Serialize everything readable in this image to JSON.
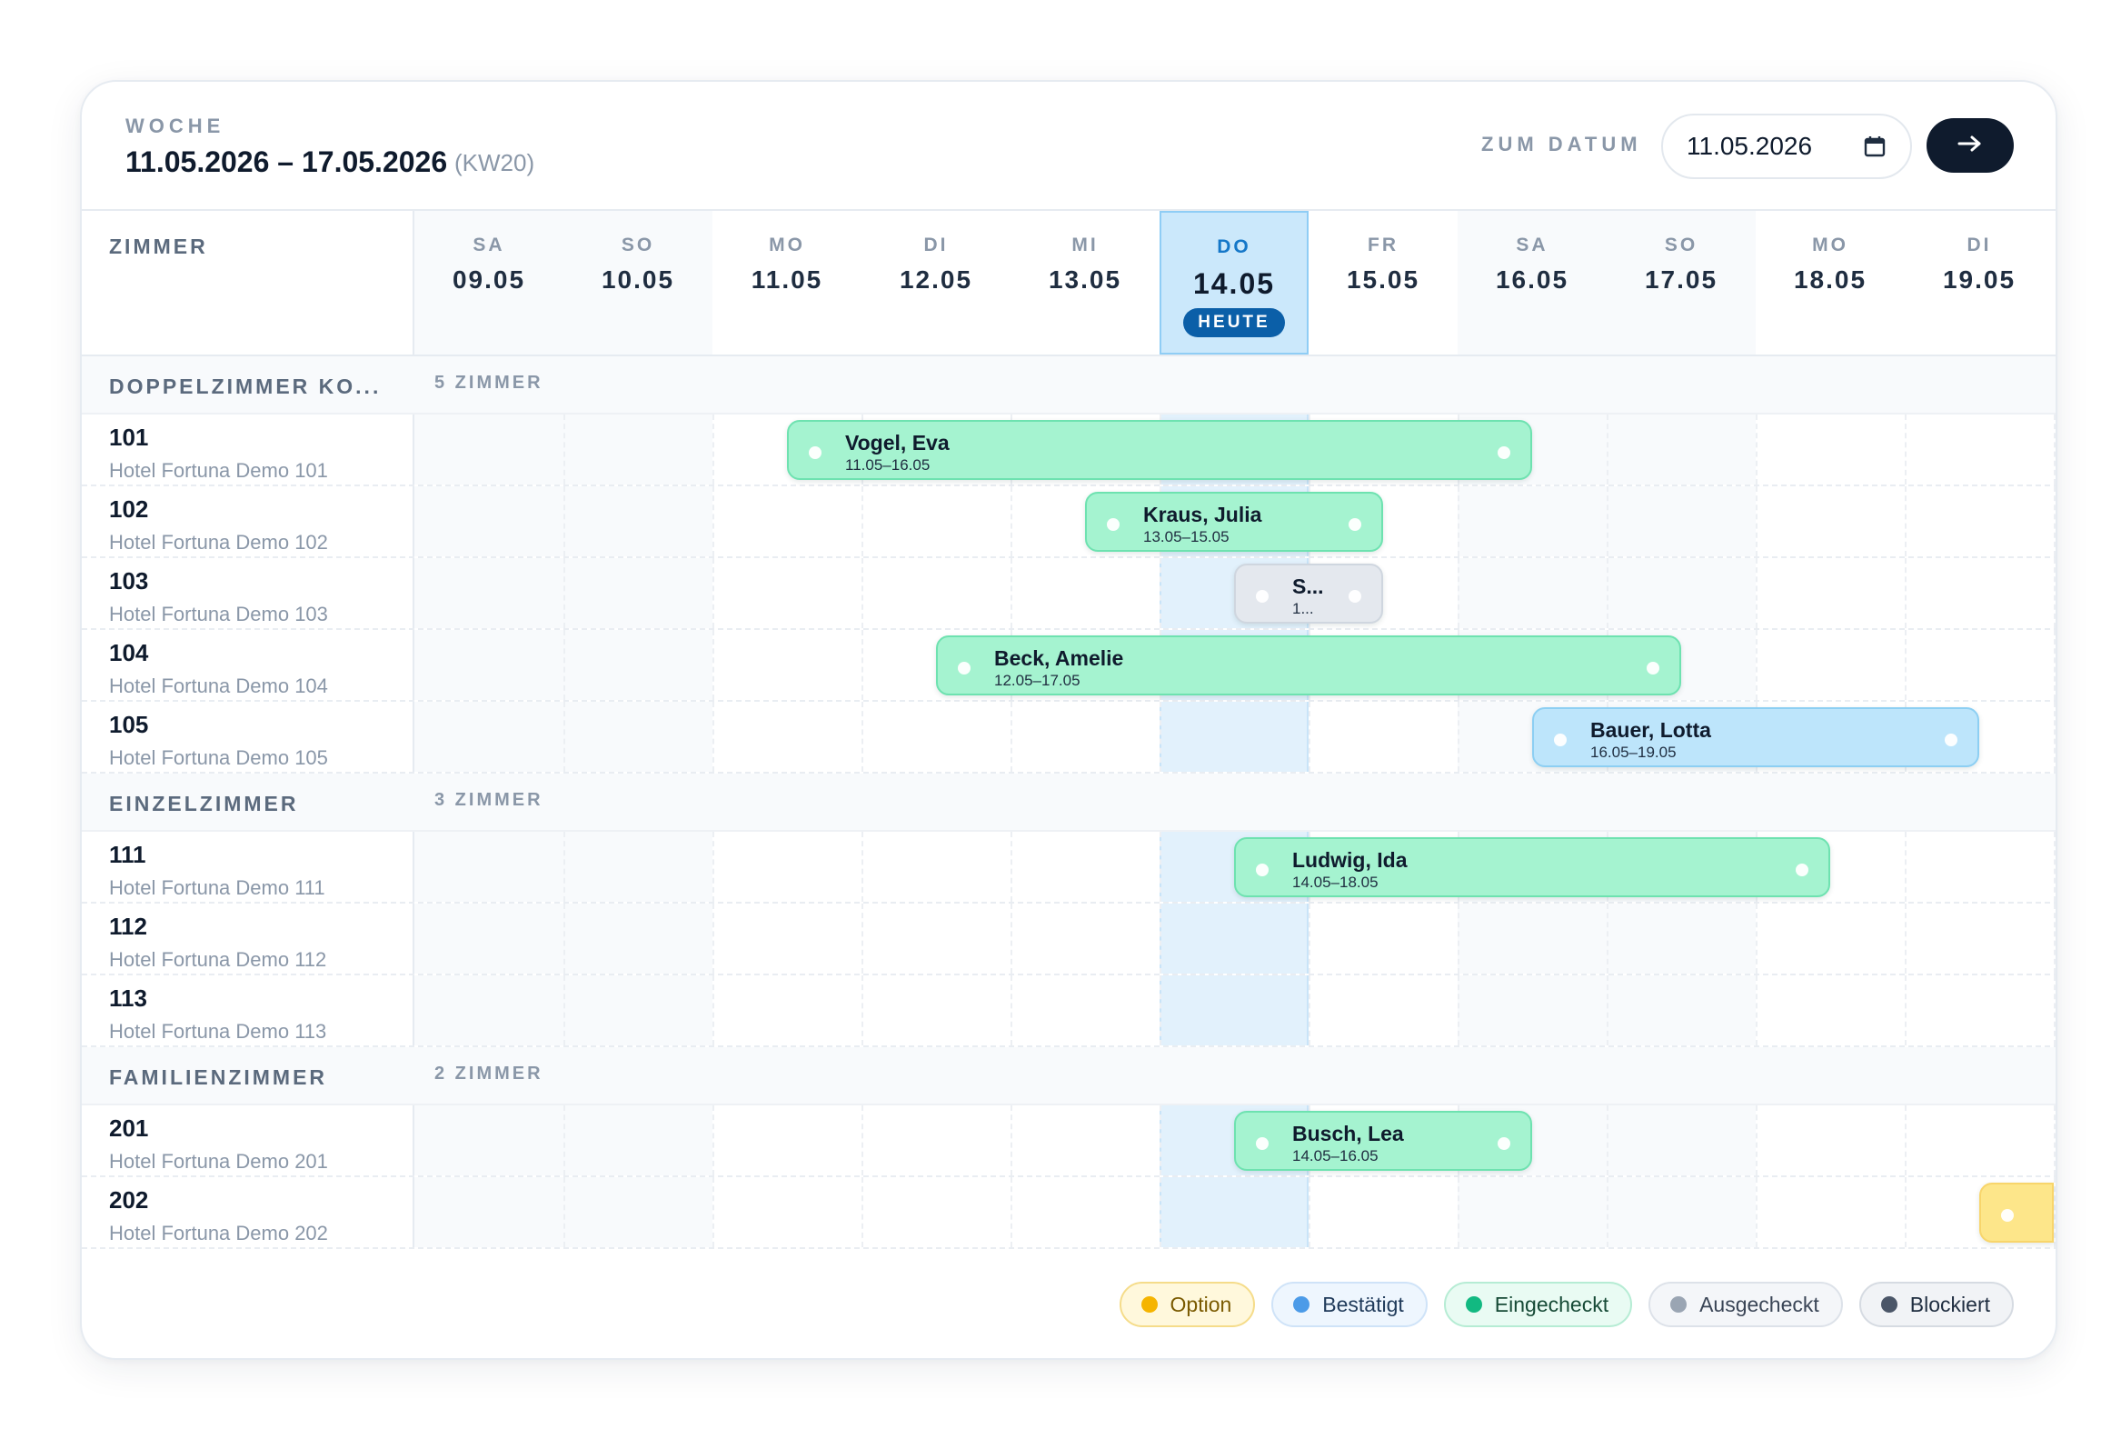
{
  "header": {
    "week_label": "WOCHE",
    "week_range": "11.05.2026 – 17.05.2026",
    "week_kw": "(KW20)",
    "goto_label": "ZUM DATUM",
    "date_value": "11.05.2026",
    "calendar_icon": "calendar-icon",
    "go_icon": "arrow-right-icon"
  },
  "grid": {
    "rooms_header": "ZIMMER",
    "today_badge": "HEUTE",
    "days": [
      {
        "dow": "SA",
        "date": "09.05"
      },
      {
        "dow": "SO",
        "date": "10.05"
      },
      {
        "dow": "MO",
        "date": "11.05"
      },
      {
        "dow": "DI",
        "date": "12.05"
      },
      {
        "dow": "MI",
        "date": "13.05"
      },
      {
        "dow": "DO",
        "date": "14.05"
      },
      {
        "dow": "FR",
        "date": "15.05"
      },
      {
        "dow": "SA",
        "date": "16.05"
      },
      {
        "dow": "SO",
        "date": "17.05"
      },
      {
        "dow": "MO",
        "date": "18.05"
      },
      {
        "dow": "DI",
        "date": "19.05"
      }
    ],
    "groups": [
      {
        "name": "DOPPELZIMMER KO...",
        "count": "5 ZIMMER",
        "rooms": [
          {
            "no": "101",
            "hotel": "Hotel Fortuna Demo 101"
          },
          {
            "no": "102",
            "hotel": "Hotel Fortuna Demo 102"
          },
          {
            "no": "103",
            "hotel": "Hotel Fortuna Demo 103"
          },
          {
            "no": "104",
            "hotel": "Hotel Fortuna Demo 104"
          },
          {
            "no": "105",
            "hotel": "Hotel Fortuna Demo 105"
          }
        ]
      },
      {
        "name": "EINZELZIMMER",
        "count": "3 ZIMMER",
        "rooms": [
          {
            "no": "111",
            "hotel": "Hotel Fortuna Demo 111"
          },
          {
            "no": "112",
            "hotel": "Hotel Fortuna Demo 112"
          },
          {
            "no": "113",
            "hotel": "Hotel Fortuna Demo 113"
          }
        ]
      },
      {
        "name": "FAMILIENZIMMER",
        "count": "2 ZIMMER",
        "rooms": [
          {
            "no": "201",
            "hotel": "Hotel Fortuna Demo 201"
          },
          {
            "no": "202",
            "hotel": "Hotel Fortuna Demo 202"
          }
        ]
      }
    ],
    "bookings": [
      {
        "guest": "Vogel, Eva",
        "dates": "11.05–16.05",
        "status": "green"
      },
      {
        "guest": "Kraus, Julia",
        "dates": "13.05–15.05",
        "status": "green"
      },
      {
        "guest": "S...",
        "dates": "1...",
        "status": "grey"
      },
      {
        "guest": "Beck, Amelie",
        "dates": "12.05–17.05",
        "status": "green"
      },
      {
        "guest": "Bauer, Lotta",
        "dates": "16.05–19.05",
        "status": "blue"
      },
      {
        "guest": "Ludwig, Ida",
        "dates": "14.05–18.05",
        "status": "green"
      },
      {
        "guest": "Busch, Lea",
        "dates": "14.05–16.05",
        "status": "green"
      },
      {
        "guest": "",
        "dates": "",
        "status": "yellow"
      }
    ]
  },
  "legend": [
    {
      "label": "Option",
      "color": "#f5b400"
    },
    {
      "label": "Bestätigt",
      "color": "#4c9be8"
    },
    {
      "label": "Eingecheckt",
      "color": "#12b981"
    },
    {
      "label": "Ausgecheckt",
      "color": "#9aa5b3"
    },
    {
      "label": "Blockiert",
      "color": "#4b5668"
    }
  ]
}
